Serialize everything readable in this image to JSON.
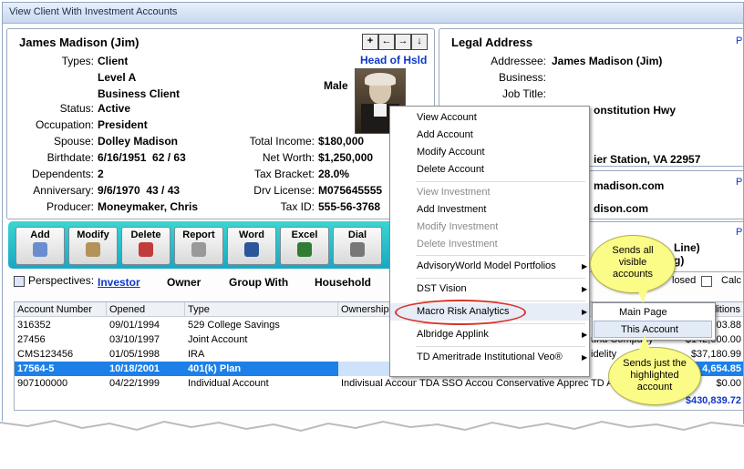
{
  "window": {
    "title": "View Client With Investment Accounts"
  },
  "client": {
    "name": "James Madison (Jim)",
    "head_of_household": "Head of Hsld",
    "gender": "Male",
    "labels": {
      "types": "Types:",
      "status": "Status:",
      "occupation": "Occupation:",
      "spouse": "Spouse:",
      "birthdate": "Birthdate:",
      "dependents": "Dependents:",
      "anniversary": "Anniversary:",
      "producer": "Producer:",
      "total_income": "Total Income:",
      "net_worth": "Net Worth:",
      "tax_bracket": "Tax Bracket:",
      "drv_license": "Drv License:",
      "tax_id": "Tax ID:"
    },
    "types": [
      "Client",
      "Level A",
      "Business Client"
    ],
    "status": "Active",
    "occupation": "President",
    "spouse": "Dolley Madison",
    "birthdate": "6/16/1951  62 / 63",
    "dependents": "2",
    "anniversary": "9/6/1970  43 / 43",
    "producer": "Moneymaker, Chris",
    "total_income": "$180,000",
    "net_worth": "$1,250,000",
    "tax_bracket": "28.0%",
    "drv_license": "M075645555",
    "tax_id": "555-56-3768"
  },
  "nav_buttons": [
    "+",
    "←",
    "→",
    "↓"
  ],
  "legal_address": {
    "title": "Legal Address",
    "labels": {
      "addressee": "Addressee:",
      "business": "Business:",
      "job_title": "Job Title:"
    },
    "addressee": "James Madison (Jim)",
    "street_partial": "onstitution Hwy",
    "city_partial": "ier Station,  VA  22957",
    "email1_partial": "madison.com",
    "email2_partial": "dison.com",
    "line_partial": "Line)",
    "g_partial": "g)",
    "closed_label": "losed",
    "calc_label": "Calc",
    "p_marks": [
      "P",
      "P",
      "P"
    ]
  },
  "toolbar": [
    "Add",
    "Modify",
    "Delete",
    "Report",
    "Word",
    "Excel",
    "Dial"
  ],
  "perspectives": {
    "label": "Perspectives:",
    "active": "Investor",
    "items": [
      "Owner",
      "Group With",
      "Household"
    ]
  },
  "grid": {
    "headers": [
      "Account Number",
      "Opened",
      "Type",
      "Ownership",
      "",
      "",
      "",
      "ditions"
    ],
    "rows": [
      {
        "acct": "316352",
        "opened": "09/01/1994",
        "type": "529 College Savings",
        "own": "",
        "c5": "",
        "c6": "",
        "c7": "",
        "amt": "003.88"
      },
      {
        "acct": "27456",
        "opened": "03/10/1997",
        "type": "Joint Account",
        "own": "",
        "c5": "",
        "c6": "",
        "c7": "und Company",
        "amt": "$142,000.00"
      },
      {
        "acct": "CMS123456",
        "opened": "01/05/1998",
        "type": "IRA",
        "own": "",
        "c5": "",
        "c6": "",
        "c7": "idelity",
        "amt": "$37,180.99"
      },
      {
        "acct": "17564-5",
        "opened": "10/18/2001",
        "type": "401(k) Plan",
        "own": "",
        "c5": "",
        "c6": "",
        "c7": "",
        "amt": "4,654.85"
      },
      {
        "acct": "907100000",
        "opened": "04/22/1999",
        "type": "Individual Account",
        "own": "Indivisual Accoun",
        "c5": "TDA SSO Accoun",
        "c6": "Conservative Apprecia",
        "c7": "TD A",
        "amt": "$0.00"
      }
    ],
    "total": "$430,839.72"
  },
  "context_menu": {
    "items": [
      {
        "label": "View Account",
        "disabled": false
      },
      {
        "label": "Add Account",
        "disabled": false
      },
      {
        "label": "Modify Account",
        "disabled": false
      },
      {
        "label": "Delete Account",
        "disabled": false
      },
      {
        "label": "View Investment",
        "disabled": true
      },
      {
        "label": "Add Investment",
        "disabled": false
      },
      {
        "label": "Modify Investment",
        "disabled": true
      },
      {
        "label": "Delete Investment",
        "disabled": true
      },
      {
        "label": "AdvisoryWorld Model Portfolios",
        "disabled": false
      },
      {
        "label": "DST Vision",
        "disabled": false
      },
      {
        "label": "Macro Risk Analytics",
        "disabled": false
      },
      {
        "label": "Albridge Applink",
        "disabled": false
      },
      {
        "label": "TD Ameritrade Institutional Veo®",
        "disabled": false
      }
    ],
    "submenu": [
      "Main Page",
      "This Account"
    ]
  },
  "callouts": {
    "top": [
      "Sends all",
      "visible",
      "accounts"
    ],
    "bottom": [
      "Sends just the",
      "highlighted",
      "account"
    ]
  },
  "colors": {
    "accent": "#1c80e8",
    "toolbar": "#22b8c8",
    "callout": "#fbfb87",
    "highlight_ring": "#d9342b"
  }
}
